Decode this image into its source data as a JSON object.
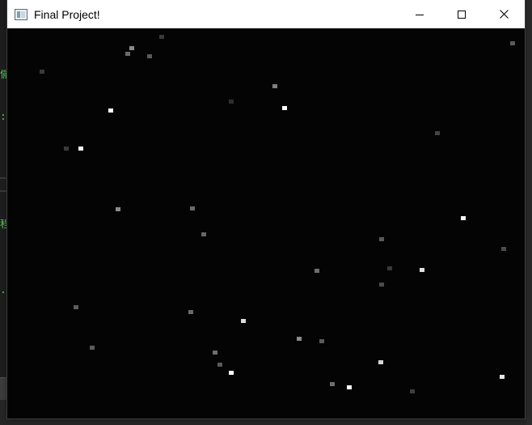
{
  "window": {
    "title": "Final Project!",
    "icon": "app-window-icon",
    "controls": [
      "minimize-icon",
      "maximize-icon",
      "close-icon"
    ]
  },
  "background": {
    "left_glyphs": [
      "偷",
      ":",
      "程",
      "."
    ],
    "glyph_color": "#4ec94e"
  },
  "canvas": {
    "background": "#040404",
    "stars": [
      {
        "c": "#3a3a3a"
      },
      {
        "c": "#8a8a8a"
      },
      {
        "c": "#6a6a6a"
      },
      {
        "c": "#5a5a5a"
      },
      {
        "c": "#5a5a5a"
      },
      {
        "c": "#3a3a3a"
      },
      {
        "c": "#2e2e2e"
      },
      {
        "c": "#7f7f7f"
      },
      {
        "c": "#444444"
      },
      {
        "c": "#ffffff"
      },
      {
        "c": "#ffffff"
      },
      {
        "c": "#3a3a3a"
      },
      {
        "c": "#ffffff"
      },
      {
        "c": "#8a8a8a"
      },
      {
        "c": "#6b6b6b"
      },
      {
        "c": "#666666"
      },
      {
        "c": "#5a5a5a"
      },
      {
        "c": "#f5f5f5"
      },
      {
        "c": "#4b4b4b"
      },
      {
        "c": "#3a3a3a"
      },
      {
        "c": "#e0e0e0"
      },
      {
        "c": "#6e6e6e"
      },
      {
        "c": "#4a4a4a"
      },
      {
        "c": "#5e5e5e"
      },
      {
        "c": "#6a6a6a"
      },
      {
        "c": "#dcdcdc"
      },
      {
        "c": "#8a8a8a"
      },
      {
        "c": "#5a5a5a"
      },
      {
        "c": "#5c5c5c"
      },
      {
        "c": "#6e6e6e"
      },
      {
        "c": "#ffffff"
      },
      {
        "c": "#5a5a5a"
      },
      {
        "c": "#d6d6d6"
      },
      {
        "c": "#e6e6e6"
      },
      {
        "c": "#3e3e3e"
      },
      {
        "c": "#6e6e6e"
      },
      {
        "c": "#ffffff"
      }
    ]
  }
}
